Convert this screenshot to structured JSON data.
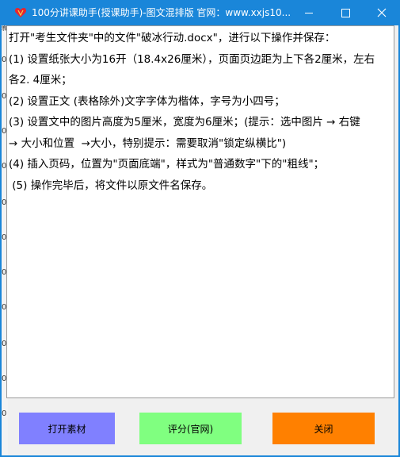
{
  "window": {
    "title": "100分讲课助手(授课助手)-图文混排版   官网：www.xxjs10...",
    "accent_color": "#1a86d9",
    "icon": "heart-icon"
  },
  "left_edge_chars": [
    "新",
    "0",
    "0",
    "0",
    "0",
    "0",
    "0",
    "0",
    "0",
    "0",
    "0",
    "0"
  ],
  "instructions": [
    "打开\"考生文件夹\"中的文件\"破冰行动.docx\"，进行以下操作并保存：",
    "(1) 设置纸张大小为16开（18.4x26厘米），页面页边距为上下各2厘米，左右",
    "各2. 4厘米；",
    "(2) 设置正文 (表格除外)文字字体为楷体，字号为小四号；",
    "(3) 设置文中的图片高度为5厘米，宽度为6厘米；(提示：选中图片 → 右键",
    "→ 大小和位置  →大小，特别提示：需要取消\"锁定纵横比\")",
    "(4) 插入页码，位置为\"页面底端\"，样式为\"普通数字\"下的\"粗线\"；",
    " (5) 操作完毕后，将文件以原文件名保存。"
  ],
  "buttons": {
    "open_label": "打开素材",
    "score_label": "评分(官网)",
    "close_label": "关闭",
    "open_color": "#8080ff",
    "score_color": "#80ff80",
    "close_color": "#ff8000"
  }
}
